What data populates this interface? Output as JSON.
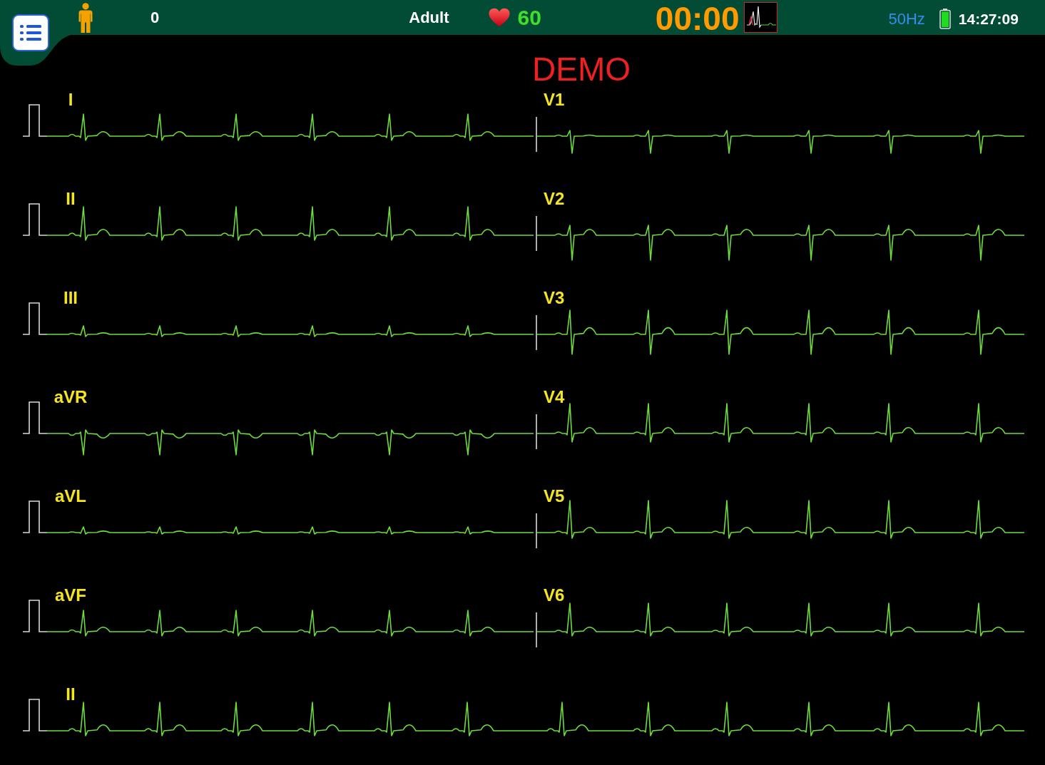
{
  "top_bar": {
    "patient_number": "0",
    "patient_type": "Adult",
    "heart_rate": "60",
    "timer": "00:00",
    "power_frequency": "50Hz",
    "clock": "14:27:09"
  },
  "mode_banner": "DEMO",
  "lead_rows": [
    {
      "left_lead": "I",
      "right_lead": "V1"
    },
    {
      "left_lead": "II",
      "right_lead": "V2"
    },
    {
      "left_lead": "III",
      "right_lead": "V3"
    },
    {
      "left_lead": "aVR",
      "right_lead": "V4"
    },
    {
      "left_lead": "aVL",
      "right_lead": "V5"
    },
    {
      "left_lead": "aVF",
      "right_lead": "V6"
    }
  ],
  "rhythm_strip": {
    "lead": "II"
  }
}
